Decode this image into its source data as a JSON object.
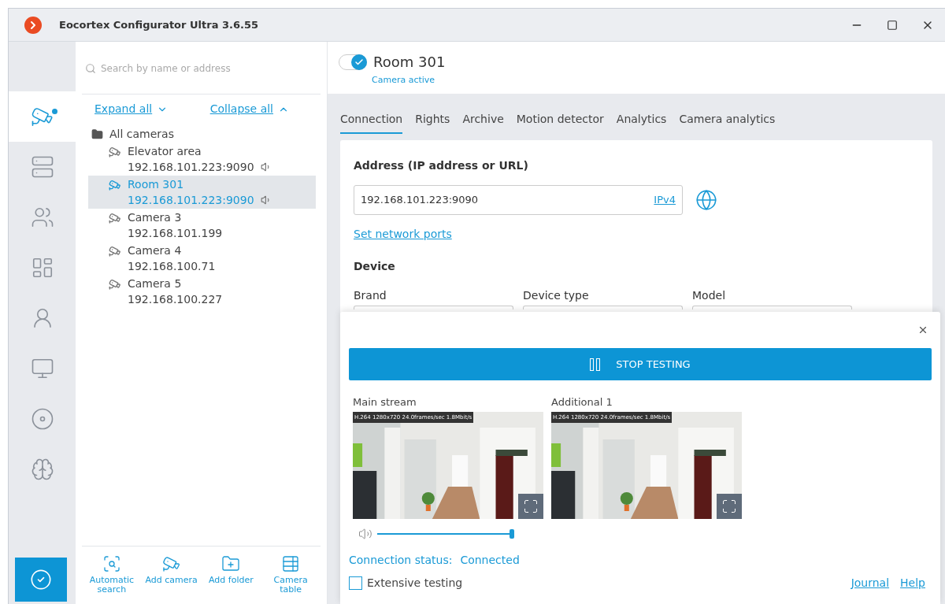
{
  "window": {
    "title": "Eocortex Configurator Ultra 3.6.55"
  },
  "rail": [
    {
      "kind": "cameras",
      "selected": true,
      "modified": true
    },
    {
      "kind": "servers",
      "selected": false,
      "modified": false
    },
    {
      "kind": "users",
      "selected": false,
      "modified": false
    },
    {
      "kind": "layouts",
      "selected": false,
      "modified": false
    },
    {
      "kind": "people",
      "selected": false,
      "modified": false
    },
    {
      "kind": "monitors",
      "selected": false,
      "modified": false
    },
    {
      "kind": "recorder",
      "selected": false,
      "modified": false
    },
    {
      "kind": "brain",
      "selected": false,
      "modified": false
    }
  ],
  "tree": {
    "search": {
      "placeholder": "Search by name or address"
    },
    "expand_all": "Expand all",
    "collapse_all": "Collapse all",
    "root": {
      "label": "All cameras",
      "children": [
        {
          "name": "Elevator area",
          "address": "192.168.101.223:9090",
          "audio": true,
          "selected": false
        },
        {
          "name": "Room 301",
          "address": "192.168.101.223:9090",
          "audio": true,
          "selected": true
        },
        {
          "name": "Camera 3",
          "address": "192.168.101.199",
          "audio": false,
          "selected": false
        },
        {
          "name": "Camera 4",
          "address": "192.168.100.71",
          "audio": false,
          "selected": false
        },
        {
          "name": "Camera 5",
          "address": "192.168.100.227",
          "audio": false,
          "selected": false
        }
      ]
    }
  },
  "toolbar": [
    {
      "kind": "search",
      "label": "Automatic search"
    },
    {
      "kind": "camera",
      "label": "Add camera"
    },
    {
      "kind": "folder",
      "label": "Add folder"
    },
    {
      "kind": "table",
      "label": "Camera table"
    }
  ],
  "camera": {
    "name": "Room 301",
    "active": true,
    "status": "Camera active"
  },
  "tabs": [
    {
      "label": "Connection",
      "selected": true
    },
    {
      "label": "Rights",
      "selected": false
    },
    {
      "label": "Archive",
      "selected": false
    },
    {
      "label": "Motion detector",
      "selected": false
    },
    {
      "label": "Analytics",
      "selected": false
    },
    {
      "label": "Camera analytics",
      "selected": false
    }
  ],
  "card": {
    "address_label": "Address (IP address or URL)",
    "address": "192.168.101.223:9090",
    "protocol": "IPv4",
    "ports_link": "Set network ports",
    "device_heading": "Device",
    "fields": [
      "Brand",
      "Device type",
      "Model"
    ]
  },
  "test": {
    "button": "STOP TESTING",
    "streams": [
      {
        "label": "Main stream",
        "info": "H.264 1280x720 24.0frames/sec 1.8Mbit/s"
      },
      {
        "label": "Additional 1",
        "info": "H.264 1280x720 24.0frames/sec 1.8Mbit/s"
      }
    ],
    "volume": {
      "level": 1
    },
    "status_label": "Connection status:",
    "status_value": "Connected",
    "extensive": {
      "label": "Extensive testing",
      "checked": false
    },
    "links": [
      "Journal",
      "Help"
    ]
  }
}
